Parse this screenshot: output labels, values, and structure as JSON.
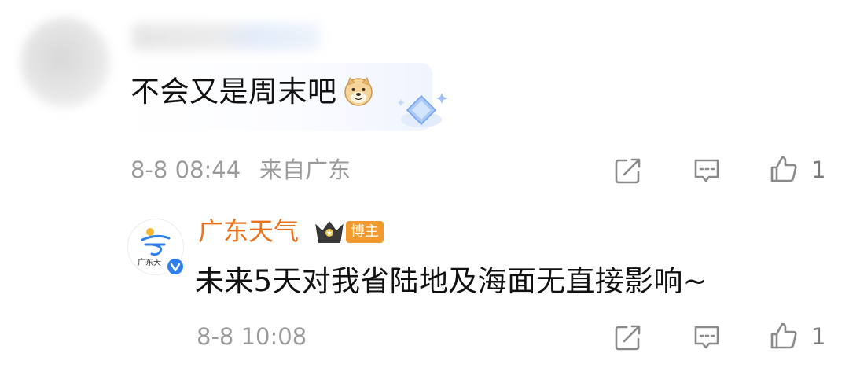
{
  "comment": {
    "text": "不会又是周末吧",
    "emoji": "doge-icon",
    "timestamp": "8-8 08:44",
    "location": "来自广东",
    "like_count": "1"
  },
  "reply": {
    "username": "广东天气",
    "badge": "博主",
    "avatar_caption": "广东天",
    "text": "未来5天对我省陆地及海面无直接影响~",
    "timestamp": "8-8 10:08",
    "like_count": "1"
  },
  "colors": {
    "username": "#e8721d",
    "badge": "#f39a2e",
    "verified": "#2f80ed",
    "meta": "#9a9a9a"
  }
}
